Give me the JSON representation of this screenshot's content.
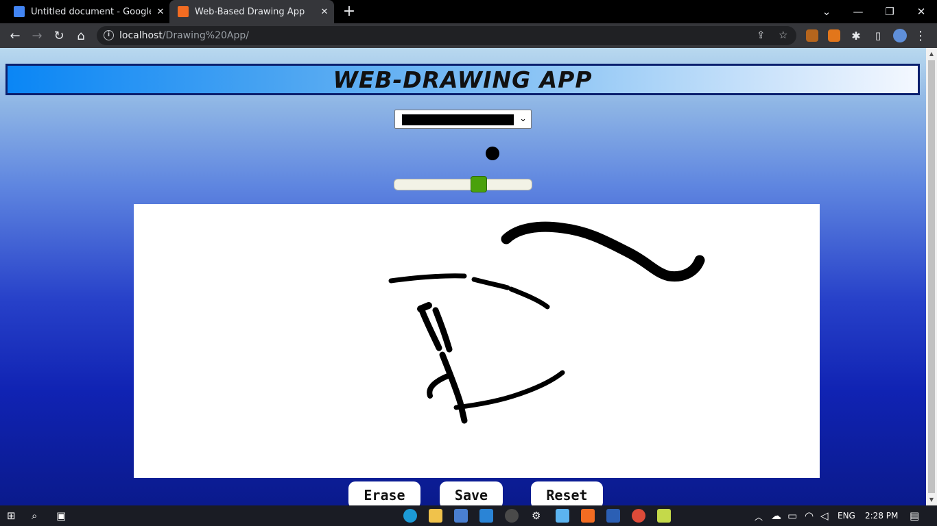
{
  "browser": {
    "tabs": [
      {
        "title": "Untitled document - Google Doc",
        "active": false
      },
      {
        "title": "Web-Based Drawing App",
        "active": true
      }
    ],
    "url_host": "localhost",
    "url_path": "/Drawing%20App/"
  },
  "app": {
    "title": "WEB-DRAWING APP",
    "selected_color": "#000000",
    "brush_size_fraction": 0.63,
    "buttons": {
      "erase": "Erase",
      "save": "Save",
      "reset": "Reset"
    }
  },
  "taskbar": {
    "language": "ENG",
    "time": "2:28 PM"
  },
  "colors": {
    "accent_green": "#4aa10b",
    "canvas_bg": "#ffffff",
    "stroke": "#000000"
  }
}
